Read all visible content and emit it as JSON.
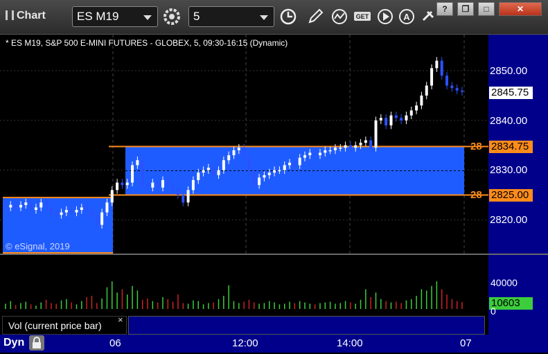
{
  "window": {
    "title": "Chart",
    "symbol": "ES M19",
    "interval": "5",
    "buttons": {
      "help": "?",
      "restore": "❐",
      "maximize": "□",
      "close": "✕"
    }
  },
  "chart": {
    "description": "* ES M19, S&P 500 E-MINI FUTURES - GLOBEX, 5, 09:30-16:15 (Dynamic)",
    "copyright": "© eSignal, 2019",
    "price_ticks": [
      "2850.00",
      "2840.00",
      "2830.00",
      "2820.00"
    ],
    "last_price": "2845.75",
    "levels": [
      {
        "label": "28",
        "value": "2834.75"
      },
      {
        "label": "28",
        "value": "2825.00"
      }
    ],
    "colors": {
      "background": "#000000",
      "axis": "#00008b",
      "zone": "#1f5cff",
      "level_line": "#ff8c1a",
      "up": "#ffffff",
      "down": "#2a52ff"
    }
  },
  "volume": {
    "legend": "Vol (current price bar)",
    "close": "×",
    "ticks": [
      "40000",
      "0"
    ],
    "last": "10603"
  },
  "time_axis": {
    "labels": [
      "06",
      "12:00",
      "14:00",
      "07"
    ],
    "mode": "Dyn"
  },
  "chart_data": {
    "type": "candlestick",
    "title": "ES M19, S&P 500 E-MINI FUTURES - GLOBEX, 5, 09:30-16:15 (Dynamic)",
    "y_range": [
      2810,
      2855
    ],
    "x_labels": [
      "06",
      "12:00",
      "14:00",
      "07"
    ],
    "zones": [
      {
        "from": 2825.0,
        "to": 2834.75
      },
      {
        "from": 2816.5,
        "to": 2824.5
      }
    ],
    "last_price": 2845.75,
    "volume_last": 10603,
    "close_series": [
      2822.5,
      2823,
      2822.5,
      2823,
      2823.5,
      2822,
      2822.5,
      2823.5,
      2822.5,
      2821.5,
      2821,
      2821.5,
      2822,
      2821.5,
      2822,
      2822.5,
      2822,
      2820.5,
      2819,
      2821.5,
      2823.5,
      2826,
      2827.5,
      2827,
      2827.5,
      2831,
      2832,
      2827,
      2826.5,
      2827.5,
      2826.5,
      2828,
      2827,
      2826,
      2825,
      2823.5,
      2826,
      2828,
      2829.5,
      2830,
      2830.5,
      2829,
      2830,
      2832,
      2833,
      2834,
      2834.5,
      2832.5,
      2829.5,
      2827,
      2828.5,
      2829,
      2829.5,
      2830,
      2830,
      2831,
      2831.5,
      2831,
      2832.5,
      2833,
      2833.5,
      2833,
      2833.5,
      2834,
      2834,
      2834.5,
      2834.5,
      2835,
      2834.5,
      2835,
      2835.5,
      2836,
      2834.5,
      2840,
      2840.5,
      2839,
      2841,
      2840.5,
      2840,
      2841,
      2842,
      2843,
      2845,
      2847,
      2850.5,
      2852,
      2849,
      2847,
      2846.5,
      2846,
      2845.75
    ],
    "volume_series": [
      8000,
      12000,
      6000,
      9000,
      11000,
      7000,
      5000,
      10000,
      14000,
      9000,
      8000,
      13000,
      15000,
      10000,
      7000,
      12000,
      18000,
      20000,
      9000,
      16000,
      33000,
      42000,
      25000,
      30000,
      22000,
      35000,
      28000,
      14000,
      16000,
      12000,
      10000,
      18000,
      15000,
      11000,
      22000,
      9000,
      8000,
      13000,
      12000,
      7000,
      9000,
      10000,
      15000,
      20000,
      36000,
      12000,
      9000,
      11000,
      14000,
      10000,
      8000,
      9000,
      12000,
      10000,
      7000,
      8000,
      11000,
      9000,
      12000,
      10000,
      8000,
      7000,
      9000,
      10000,
      11000,
      8000,
      9000,
      12000,
      10000,
      8000,
      14000,
      30000,
      18000,
      25000,
      15000,
      12000,
      10000,
      11000,
      9000,
      13000,
      15000,
      20000,
      30000,
      28000,
      35000,
      42000,
      30000,
      22000,
      15000,
      12000,
      10603
    ]
  }
}
